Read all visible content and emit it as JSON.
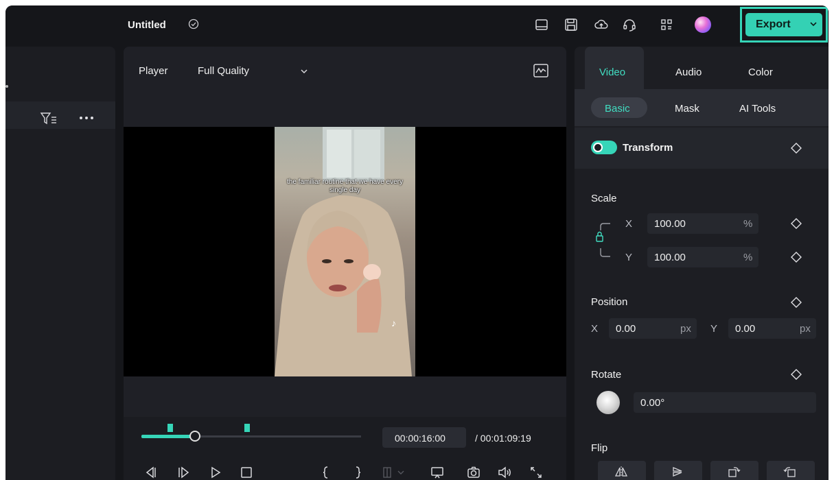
{
  "app": {
    "project_title": "Untitled",
    "accent": "#36d5b8",
    "toolbar_icons": [
      "layout-icon",
      "save-icon",
      "cloud-upload-icon",
      "headset-icon",
      "apps-grid-icon",
      "avatar"
    ],
    "export_label": "Export"
  },
  "player": {
    "label": "Player",
    "quality": "Full Quality",
    "caption": "the familiar routine that we have every single day",
    "current_time": "00:00:16:00",
    "total_time": "/ 00:01:09:19"
  },
  "inspector": {
    "tabs": [
      "Video",
      "Audio",
      "Color"
    ],
    "subtabs": [
      "Basic",
      "Mask",
      "AI Tools"
    ],
    "transform_label": "Transform",
    "scale": {
      "label": "Scale",
      "x_axis": "X",
      "y_axis": "Y",
      "x_value": "100.00",
      "y_value": "100.00",
      "unit": "%"
    },
    "position": {
      "label": "Position",
      "x_axis": "X",
      "y_axis": "Y",
      "x_value": "0.00",
      "y_value": "0.00",
      "unit": "px"
    },
    "rotate": {
      "label": "Rotate",
      "value": "0.00°"
    },
    "flip": {
      "label": "Flip"
    }
  }
}
